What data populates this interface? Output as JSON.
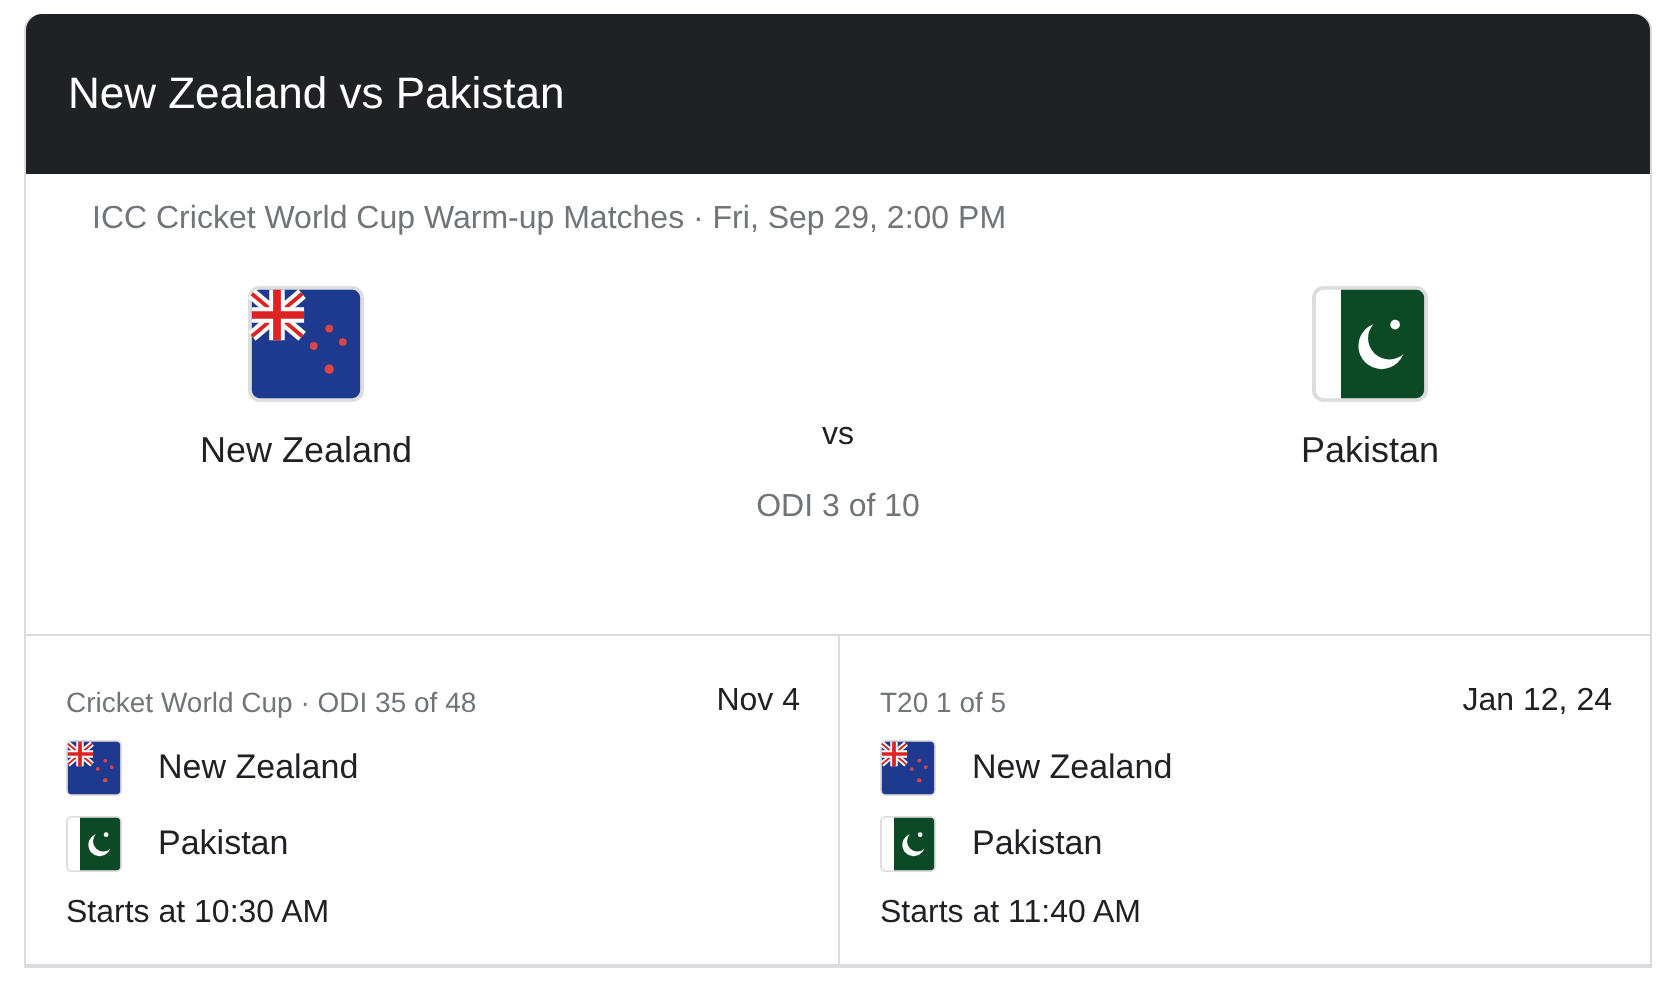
{
  "header": {
    "title": "New Zealand vs Pakistan"
  },
  "featured": {
    "subtitle": "ICC Cricket World Cup Warm-up Matches · Fri, Sep 29, 2:00 PM",
    "teams": [
      "New Zealand",
      "Pakistan"
    ],
    "vs": "vs",
    "series": "ODI 3 of 10"
  },
  "upcoming": [
    {
      "series": "Cricket World Cup · ODI 35 of 48",
      "date": "Nov 4",
      "teams": [
        "New Zealand",
        "Pakistan"
      ],
      "start": "Starts at 10:30 AM"
    },
    {
      "series": "T20 1 of 5",
      "date": "Jan 12, 24",
      "teams": [
        "New Zealand",
        "Pakistan"
      ],
      "start": "Starts at 11:40 AM"
    }
  ]
}
